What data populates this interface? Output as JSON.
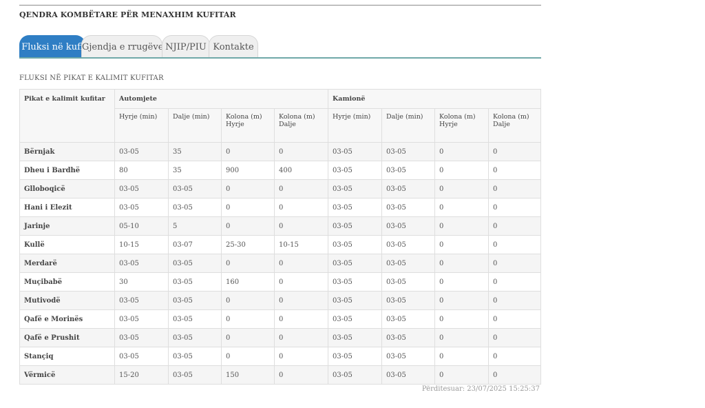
{
  "header": {
    "title": "QENDRA KOMBËTARE PËR MENAXHIM KUFITAR"
  },
  "tabs": [
    {
      "label": "Fluksi në kufi"
    },
    {
      "label": "Gjendja e rrugëve"
    },
    {
      "label": "NJIP/PIU"
    },
    {
      "label": "Kontakte"
    }
  ],
  "section": {
    "title": "FLUKSI NË PIKAT E KALIMIT KUFITAR"
  },
  "table": {
    "corner": "Pikat e kalimit kufitar",
    "group1": "Automjete",
    "group2": "Kamionë",
    "cols": [
      "Hyrje (min)",
      "Dalje (min)",
      "Kolona (m) Hyrje",
      "Kolona (m) Dalje",
      "Hyrje (min)",
      "Dalje (min)",
      "Kolona (m) Hyrje",
      "Kolona (m) Dalje"
    ],
    "rows": [
      [
        "Bërnjak",
        "03-05",
        "35",
        "0",
        "0",
        "03-05",
        "03-05",
        "0",
        "0"
      ],
      [
        "Dheu i Bardhë",
        "80",
        "35",
        "900",
        "400",
        "03-05",
        "03-05",
        "0",
        "0"
      ],
      [
        "Glloboqicë",
        "03-05",
        "03-05",
        "0",
        "0",
        "03-05",
        "03-05",
        "0",
        "0"
      ],
      [
        "Hani i Elezit",
        "03-05",
        "03-05",
        "0",
        "0",
        "03-05",
        "03-05",
        "0",
        "0"
      ],
      [
        "Jarinje",
        "05-10",
        "5",
        "0",
        "0",
        "03-05",
        "03-05",
        "0",
        "0"
      ],
      [
        "Kullë",
        "10-15",
        "03-07",
        "25-30",
        "10-15",
        "03-05",
        "03-05",
        "0",
        "0"
      ],
      [
        "Merdarë",
        "03-05",
        "03-05",
        "0",
        "0",
        "03-05",
        "03-05",
        "0",
        "0"
      ],
      [
        "Muçibabë",
        "30",
        "03-05",
        "160",
        "0",
        "03-05",
        "03-05",
        "0",
        "0"
      ],
      [
        "Mutivodë",
        "03-05",
        "03-05",
        "0",
        "0",
        "03-05",
        "03-05",
        "0",
        "0"
      ],
      [
        "Qafë e Morinës",
        "03-05",
        "03-05",
        "0",
        "0",
        "03-05",
        "03-05",
        "0",
        "0"
      ],
      [
        "Qafë e Prushit",
        "03-05",
        "03-05",
        "0",
        "0",
        "03-05",
        "03-05",
        "0",
        "0"
      ],
      [
        "Stançiq",
        "03-05",
        "03-05",
        "0",
        "0",
        "03-05",
        "03-05",
        "0",
        "0"
      ],
      [
        "Vërmicë",
        "15-20",
        "03-05",
        "150",
        "0",
        "03-05",
        "03-05",
        "0",
        "0"
      ]
    ]
  },
  "footer": {
    "updated": "Përditesuar: 23/07/2025 15:25:37"
  },
  "colors": {
    "accent": "#2f7ec4",
    "tab_line": "#6fa8a8"
  }
}
